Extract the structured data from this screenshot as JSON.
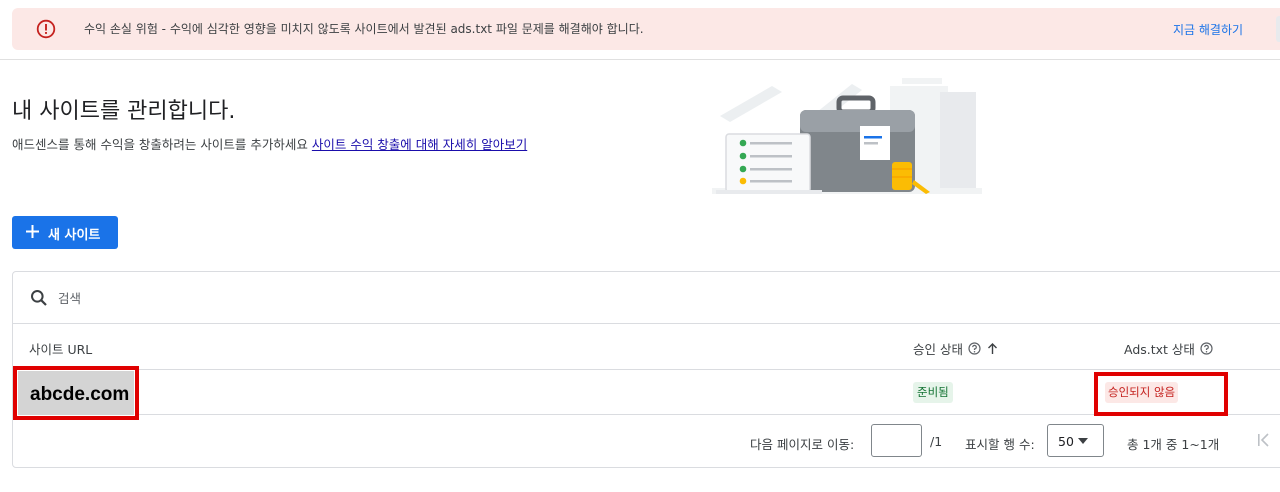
{
  "alert": {
    "icon": "error-circle-icon",
    "message": "수익 손실 위험 - 수익에 심각한 영향을 미치지 않도록 사이트에서 발견된 ads.txt 파일 문제를 해결해야 합니다.",
    "action_label": "지금 해결하기",
    "color_bg": "#fce8e6",
    "color_icon": "#c5221f"
  },
  "header": {
    "title": "내 사이트를 관리합니다.",
    "subtitle": "애드센스를 통해 수익을 창출하려는 사이트를 추가하세요",
    "learn_more_link": "사이트 수익 창출에 대해 자세히 알아보기"
  },
  "new_site_button": {
    "label": "새 사이트",
    "icon": "plus-icon",
    "color": "#1a73e8"
  },
  "search": {
    "placeholder": "검색",
    "icon": "search-icon"
  },
  "table": {
    "columns": [
      "사이트 URL",
      "승인 상태",
      "Ads.txt 상태"
    ],
    "rows": [
      {
        "site_url": "abcde.com",
        "approval_status": "준비됨",
        "ads_txt_status": "승인되지 않음"
      }
    ]
  },
  "pagination": {
    "goto_label": "다음 페이지로 이동:",
    "goto_value": "",
    "total_pages": "/1",
    "rows_label": "표시할 행 수:",
    "rows_value": "50",
    "count_text": "총 1개 중 1~1개"
  }
}
